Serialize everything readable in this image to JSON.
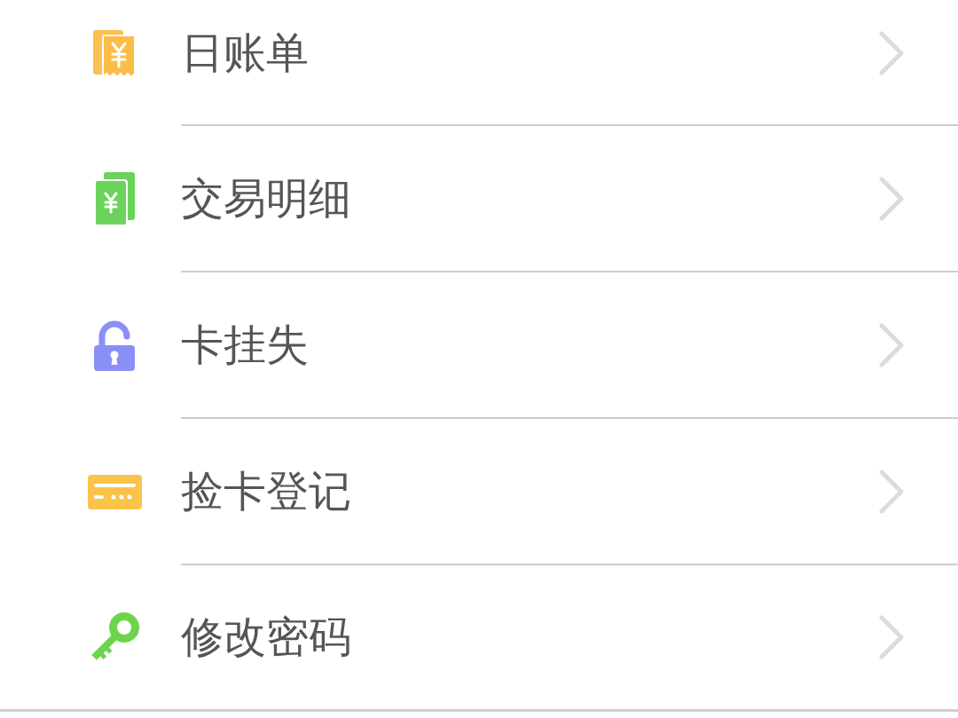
{
  "menu": [
    {
      "kind": "receipt",
      "label": "日账单"
    },
    {
      "kind": "bills",
      "label": "交易明细"
    },
    {
      "kind": "lock",
      "label": "卡挂失"
    },
    {
      "kind": "card",
      "label": "捡卡登记"
    },
    {
      "kind": "key",
      "label": "修改密码"
    }
  ]
}
